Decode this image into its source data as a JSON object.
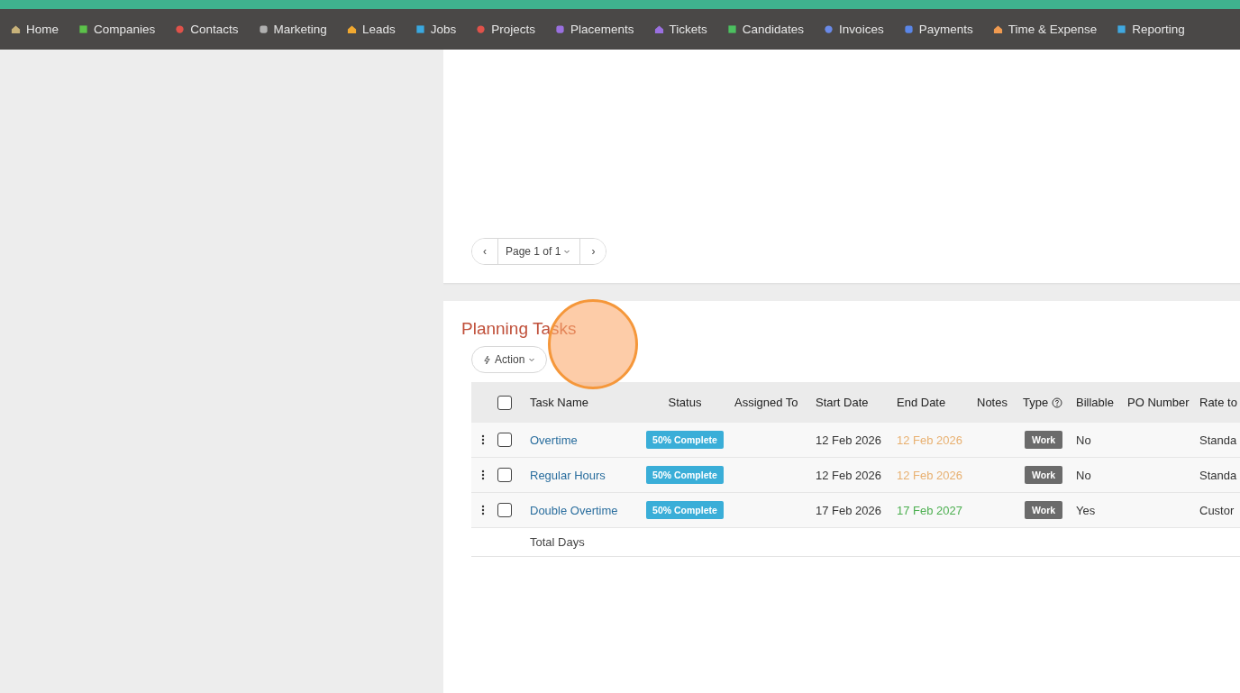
{
  "nav": [
    {
      "label": "Home",
      "color": "#c8b27a"
    },
    {
      "label": "Companies",
      "color": "#5cc24a"
    },
    {
      "label": "Contacts",
      "color": "#e0524a"
    },
    {
      "label": "Marketing",
      "color": "#b0b0b0"
    },
    {
      "label": "Leads",
      "color": "#f0a830"
    },
    {
      "label": "Jobs",
      "color": "#3aa8e0"
    },
    {
      "label": "Projects",
      "color": "#e0524a"
    },
    {
      "label": "Placements",
      "color": "#9a70e0"
    },
    {
      "label": "Tickets",
      "color": "#9a70e0"
    },
    {
      "label": "Candidates",
      "color": "#4cc060"
    },
    {
      "label": "Invoices",
      "color": "#6a8ae8"
    },
    {
      "label": "Payments",
      "color": "#5a86e8"
    },
    {
      "label": "Time & Expense",
      "color": "#f09a50"
    },
    {
      "label": "Reporting",
      "color": "#40a8e0"
    }
  ],
  "pager": {
    "prev": "‹",
    "label": "Page 1 of 1",
    "next": "›"
  },
  "tasks": {
    "title": "Planning Tasks",
    "action": "Action",
    "select_all": {
      "checked": false
    },
    "columns": [
      "Task Name",
      "Status",
      "Assigned To",
      "Start Date",
      "End Date",
      "Notes",
      "Type",
      "Billable",
      "PO Number",
      "Rate to"
    ],
    "rows": [
      {
        "checked": false,
        "name": "Overtime",
        "status": "50% Complete",
        "start": "12 Feb 2026",
        "end": {
          "text": "12 Feb 2026",
          "color": "#e8b070"
        },
        "type": "Work",
        "billable": "No",
        "rate": "Standa"
      },
      {
        "checked": false,
        "name": "Regular Hours",
        "status": "50% Complete",
        "start": "12 Feb 2026",
        "end": {
          "text": "12 Feb 2026",
          "color": "#e8b070"
        },
        "type": "Work",
        "billable": "No",
        "rate": "Standa"
      },
      {
        "checked": false,
        "name": "Double Overtime",
        "status": "50% Complete",
        "start": "17 Feb 2026",
        "end": {
          "text": "17 Feb 2027",
          "color": "#4caf50"
        },
        "type": "Work",
        "billable": "Yes",
        "rate": "Custor"
      }
    ],
    "total_label": "Total Days"
  }
}
